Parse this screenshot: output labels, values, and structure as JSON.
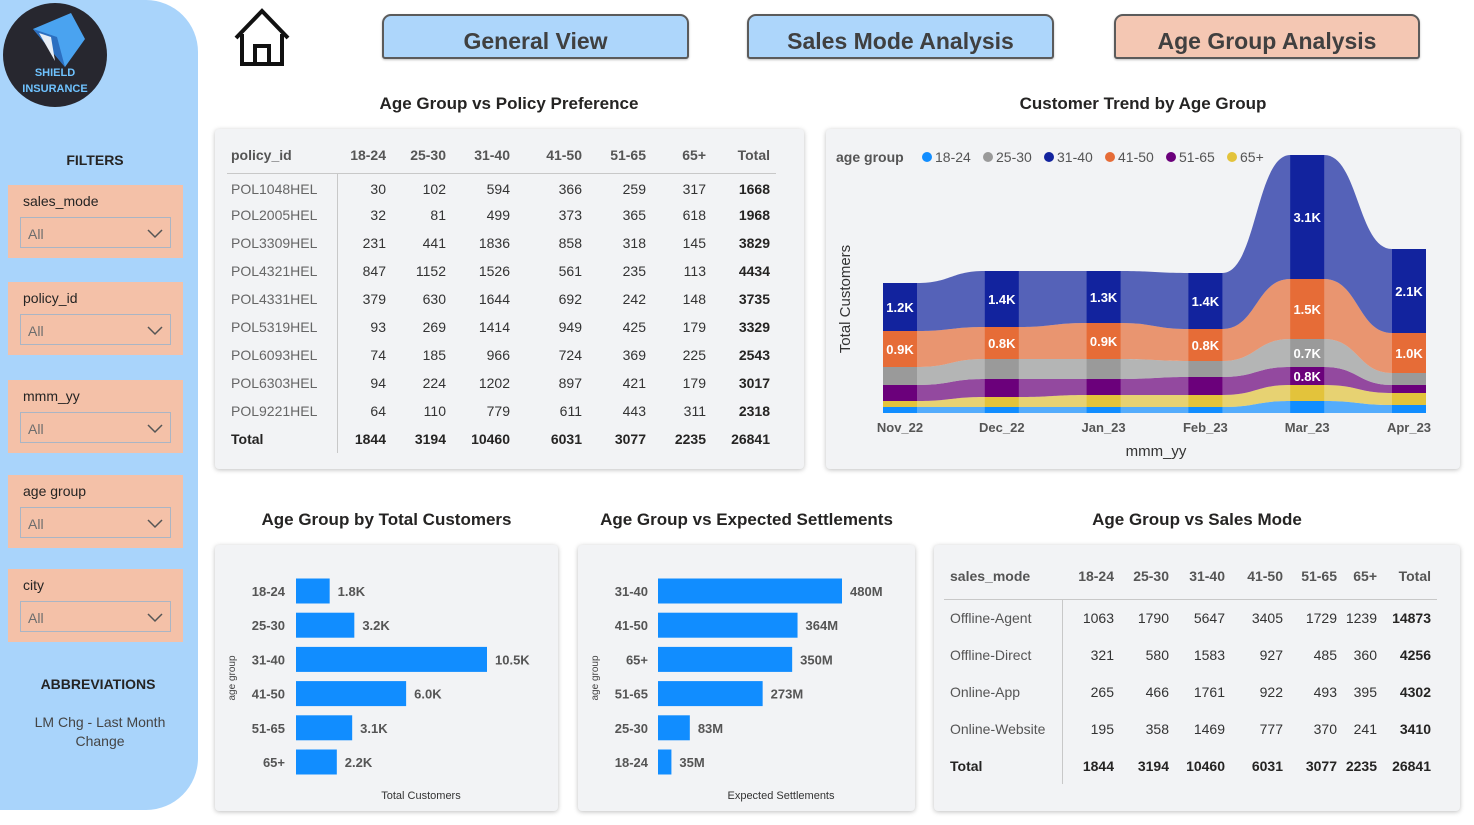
{
  "logo": {
    "line1": "SHIELD",
    "line2": "INSURANCE"
  },
  "filters": {
    "title": "FILTERS",
    "slicers": [
      {
        "label": "sales_mode",
        "value": "All"
      },
      {
        "label": "policy_id",
        "value": "All"
      },
      {
        "label": "mmm_yy",
        "value": "All"
      },
      {
        "label": "age group",
        "value": "All"
      },
      {
        "label": "city",
        "value": "All"
      }
    ]
  },
  "abbreviations": {
    "title": "ABBREVIATIONS",
    "text": "LM Chg - Last Month Change"
  },
  "nav": {
    "general": "General View",
    "sales_mode": "Sales Mode Analysis",
    "age_group": "Age Group Analysis"
  },
  "colors": {
    "sidebar": "#a9d4fb",
    "slicer": "#f4c1a8",
    "nav_inactive": "#add6fb",
    "nav_active": "#f4c7b3",
    "bar": "#118dff",
    "age_18_24": "#118dff",
    "age_25_30": "#9a9a9a",
    "age_31_40": "#12239e",
    "age_41_50": "#e66c37",
    "age_51_65": "#6b007b",
    "age_65_plus": "#e3c33b"
  },
  "policy_table": {
    "title": "Age Group vs Policy Preference",
    "headers": [
      "policy_id",
      "18-24",
      "25-30",
      "31-40",
      "41-50",
      "51-65",
      "65+",
      "Total"
    ],
    "rows": [
      [
        "POL1048HEL",
        "30",
        "102",
        "594",
        "366",
        "259",
        "317",
        "1668"
      ],
      [
        "POL2005HEL",
        "32",
        "81",
        "499",
        "373",
        "365",
        "618",
        "1968"
      ],
      [
        "POL3309HEL",
        "231",
        "441",
        "1836",
        "858",
        "318",
        "145",
        "3829"
      ],
      [
        "POL4321HEL",
        "847",
        "1152",
        "1526",
        "561",
        "235",
        "113",
        "4434"
      ],
      [
        "POL4331HEL",
        "379",
        "630",
        "1644",
        "692",
        "242",
        "148",
        "3735"
      ],
      [
        "POL5319HEL",
        "93",
        "269",
        "1414",
        "949",
        "425",
        "179",
        "3329"
      ],
      [
        "POL6093HEL",
        "74",
        "185",
        "966",
        "724",
        "369",
        "225",
        "2543"
      ],
      [
        "POL6303HEL",
        "94",
        "224",
        "1202",
        "897",
        "421",
        "179",
        "3017"
      ],
      [
        "POL9221HEL",
        "64",
        "110",
        "779",
        "611",
        "443",
        "311",
        "2318"
      ]
    ],
    "total": [
      "Total",
      "1844",
      "3194",
      "10460",
      "6031",
      "3077",
      "2235",
      "26841"
    ]
  },
  "sales_table": {
    "title": "Age Group vs Sales Mode",
    "headers": [
      "sales_mode",
      "18-24",
      "25-30",
      "31-40",
      "41-50",
      "51-65",
      "65+",
      "Total"
    ],
    "rows": [
      [
        "Offline-Agent",
        "1063",
        "1790",
        "5647",
        "3405",
        "1729",
        "1239",
        "14873"
      ],
      [
        "Offline-Direct",
        "321",
        "580",
        "1583",
        "927",
        "485",
        "360",
        "4256"
      ],
      [
        "Online-App",
        "265",
        "466",
        "1761",
        "922",
        "493",
        "395",
        "4302"
      ],
      [
        "Online-Website",
        "195",
        "358",
        "1469",
        "777",
        "370",
        "241",
        "3410"
      ]
    ],
    "total": [
      "Total",
      "1844",
      "3194",
      "10460",
      "6031",
      "3077",
      "2235",
      "26841"
    ]
  },
  "chart_data": [
    {
      "type": "area",
      "title": "Customer Trend by Age Group",
      "xlabel": "mmm_yy",
      "ylabel": "Total Customers",
      "legend_title": "age group",
      "legend_position": "top-left",
      "categories": [
        "Nov_22",
        "Dec_22",
        "Jan_23",
        "Feb_23",
        "Mar_23",
        "Apr_23"
      ],
      "stacked": true,
      "series": [
        {
          "name": "18-24",
          "values": [
            0.15,
            0.15,
            0.15,
            0.15,
            0.3,
            0.2
          ]
        },
        {
          "name": "65+",
          "values": [
            0.15,
            0.25,
            0.3,
            0.3,
            0.4,
            0.3
          ]
        },
        {
          "name": "51-65",
          "values": [
            0.4,
            0.45,
            0.4,
            0.45,
            0.45,
            0.2
          ]
        },
        {
          "name": "25-30",
          "values": [
            0.45,
            0.5,
            0.5,
            0.4,
            0.7,
            0.3
          ]
        },
        {
          "name": "41-50",
          "values": [
            0.9,
            0.8,
            0.9,
            0.8,
            1.5,
            1.0
          ]
        },
        {
          "name": "31-40",
          "values": [
            1.2,
            1.4,
            1.3,
            1.4,
            3.1,
            2.1
          ]
        }
      ],
      "data_labels": [
        {
          "series": "31-40",
          "labels": [
            "1.2K",
            "1.4K",
            "1.3K",
            "1.4K",
            "3.1K",
            "2.1K"
          ]
        },
        {
          "series": "41-50",
          "labels": [
            "0.9K",
            "0.8K",
            "0.9K",
            "0.8K",
            "1.5K",
            "1.0K"
          ]
        },
        {
          "series": "51-65",
          "labels": [
            "",
            "",
            "",
            "",
            "0.8K",
            ""
          ]
        },
        {
          "series": "25-30",
          "labels": [
            "",
            "",
            "",
            "",
            "0.7K",
            ""
          ]
        }
      ],
      "legend": [
        "18-24",
        "25-30",
        "31-40",
        "41-50",
        "51-65",
        "65+"
      ],
      "grid": false
    },
    {
      "type": "bar",
      "orientation": "horizontal",
      "title": "Age Group by Total Customers",
      "xlabel": "Total Customers",
      "ylabel": "age group",
      "categories": [
        "18-24",
        "25-30",
        "31-40",
        "41-50",
        "51-65",
        "65+"
      ],
      "values": [
        1844,
        3194,
        10460,
        6031,
        3077,
        2235
      ],
      "labels": [
        "1.8K",
        "3.2K",
        "10.5K",
        "6.0K",
        "3.1K",
        "2.2K"
      ],
      "grid": false
    },
    {
      "type": "bar",
      "orientation": "horizontal",
      "title": "Age Group vs Expected Settlements",
      "xlabel": "Expected Settlements",
      "ylabel": "age group",
      "categories": [
        "31-40",
        "41-50",
        "65+",
        "51-65",
        "25-30",
        "18-24"
      ],
      "values": [
        480,
        364,
        350,
        273,
        83,
        35
      ],
      "labels": [
        "480M",
        "364M",
        "350M",
        "273M",
        "83M",
        "35M"
      ],
      "grid": false
    }
  ]
}
